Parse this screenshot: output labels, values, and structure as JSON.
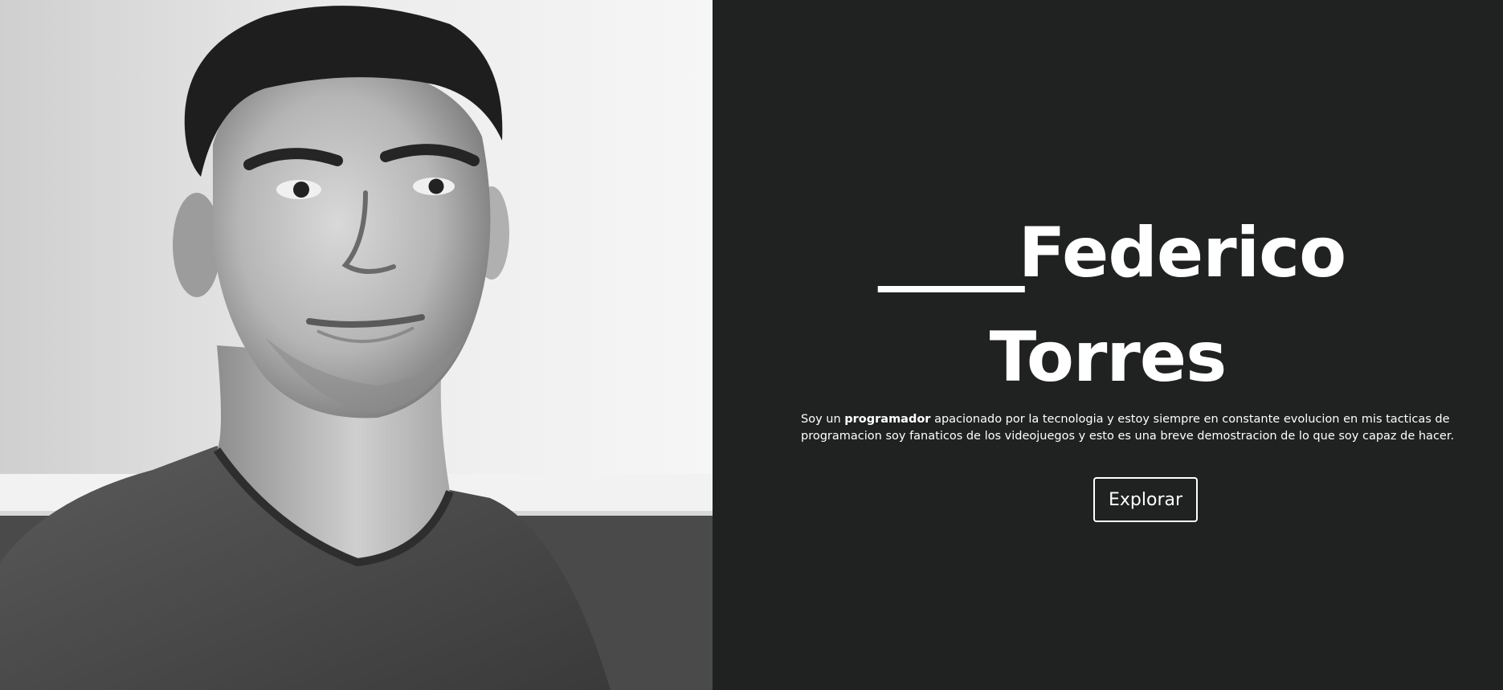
{
  "hero": {
    "name_prefix": "_____",
    "first_name": "Federico",
    "last_name": "Torres"
  },
  "bio": {
    "intro": "Soy un ",
    "highlight": "programador",
    "rest_line1": " apacionado por la tecnologia y estoy siempre en constante evolucion en mis tacticas de",
    "line2": "programacion soy fanaticos de los videojuegos y esto es una breve demostracion de lo que soy capaz de hacer."
  },
  "cta": {
    "label": "Explorar"
  },
  "colors": {
    "background": "#202121",
    "text": "#ffffff",
    "button_border": "#ffffff"
  }
}
